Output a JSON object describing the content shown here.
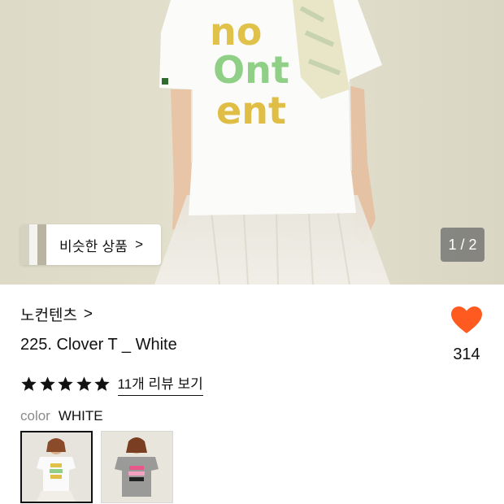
{
  "gallery": {
    "pager": "1 / 2",
    "similar_label": "비슷한 상품",
    "similar_chevron": ">"
  },
  "product": {
    "brand": "노컨텐츠",
    "brand_chevron": ">",
    "title": "225. Clover T _ White",
    "like_count": "314",
    "rating": 5,
    "review_link": "11개 리뷰 보기"
  },
  "option": {
    "name": "color",
    "value": "WHITE",
    "swatches": [
      {
        "name": "white",
        "selected": true
      },
      {
        "name": "grey",
        "selected": false
      }
    ]
  },
  "colors": {
    "heart": "#ff5a1f",
    "star": "#111111",
    "background_wall": "#dfdccb"
  },
  "icons": {
    "heart": "heart-icon",
    "star": "star-icon",
    "chevron": "chevron-right-icon"
  }
}
